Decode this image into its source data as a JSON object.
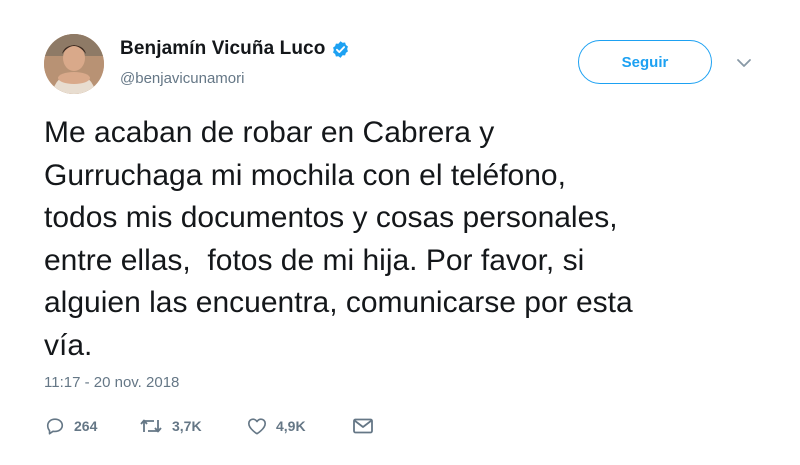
{
  "user": {
    "display_name": "Benjamín Vicuña Luco",
    "handle": "@benjavicunamori",
    "verified_icon": "verified-badge-icon"
  },
  "follow_button": {
    "label": "Seguir"
  },
  "tweet": {
    "text": "Me acaban de robar en Cabrera y\nGurruchaga mi mochila con el teléfono,\ntodos mis documentos y cosas personales,\nentre ellas,  fotos de mi hija. Por favor, si\nalguien las encuentra, comunicarse por esta\nvía.",
    "timestamp": "11:17 - 20 nov. 2018"
  },
  "actions": {
    "replies": "264",
    "retweets": "3,7K",
    "likes": "4,9K"
  },
  "colors": {
    "accent": "#1da1f2",
    "text": "#14171a",
    "muted": "#657786"
  }
}
